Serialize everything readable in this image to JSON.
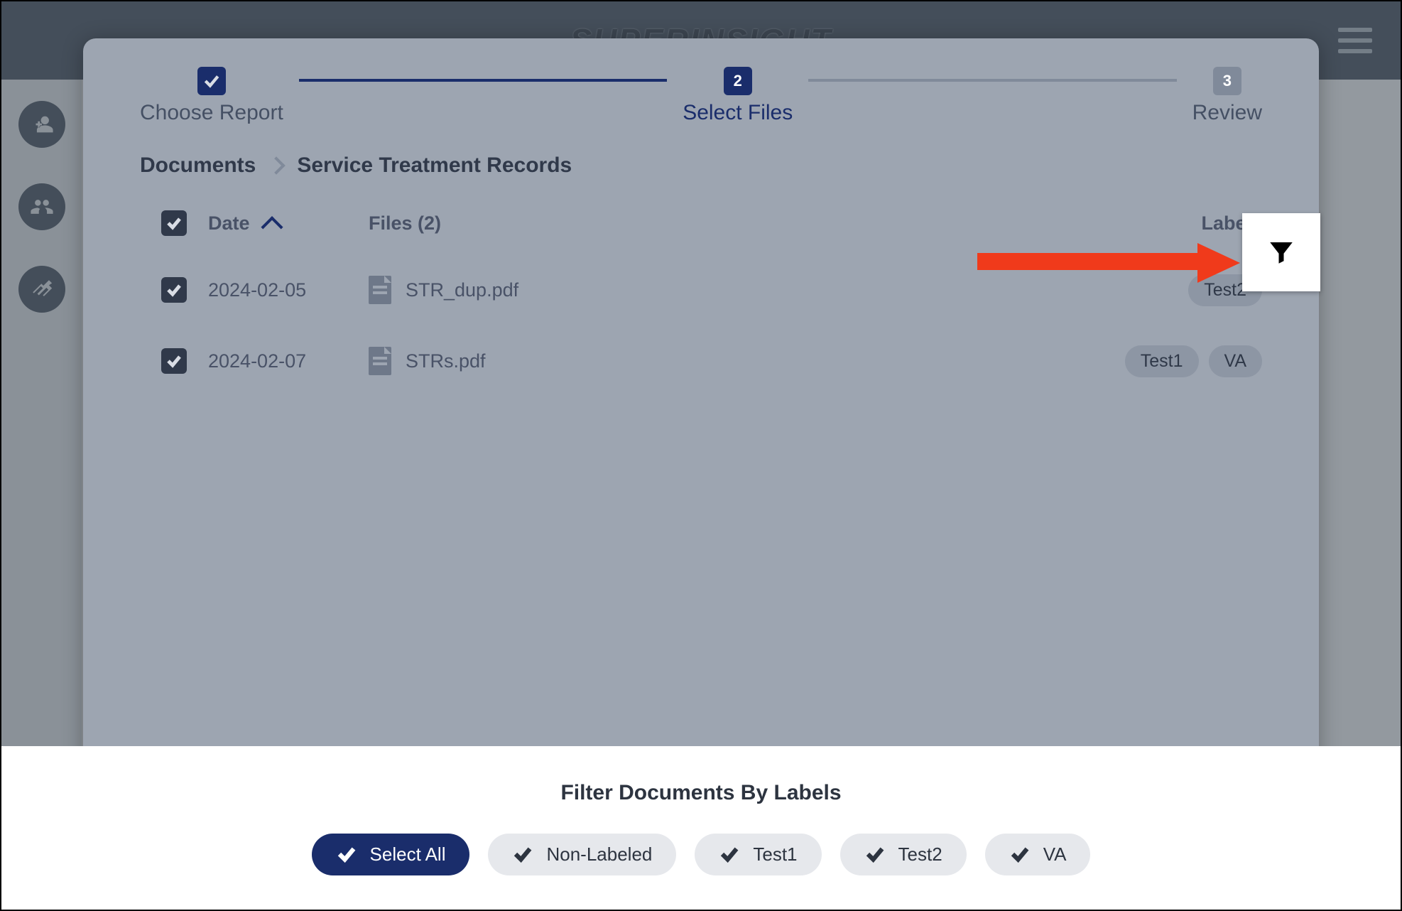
{
  "brand": "SUPERINSIGHT",
  "stepper": {
    "step1": "Choose Report",
    "step2": "Select Files",
    "step3": "Review",
    "step2num": "2",
    "step3num": "3"
  },
  "breadcrumb": {
    "root": "Documents",
    "current": "Service Treatment Records"
  },
  "table": {
    "head_date": "Date",
    "head_files": "Files (2)",
    "head_labels": "Labels",
    "rows": [
      {
        "date": "2024-02-05",
        "file": "STR_dup.pdf",
        "labels": [
          "Test2"
        ]
      },
      {
        "date": "2024-02-07",
        "file": "STRs.pdf",
        "labels": [
          "Test1",
          "VA"
        ]
      }
    ]
  },
  "sheet": {
    "title": "Filter Documents By Labels",
    "pills": [
      {
        "label": "Select All",
        "active": true
      },
      {
        "label": "Non-Labeled",
        "active": false
      },
      {
        "label": "Test1",
        "active": false
      },
      {
        "label": "Test2",
        "active": false
      },
      {
        "label": "VA",
        "active": false
      }
    ]
  }
}
